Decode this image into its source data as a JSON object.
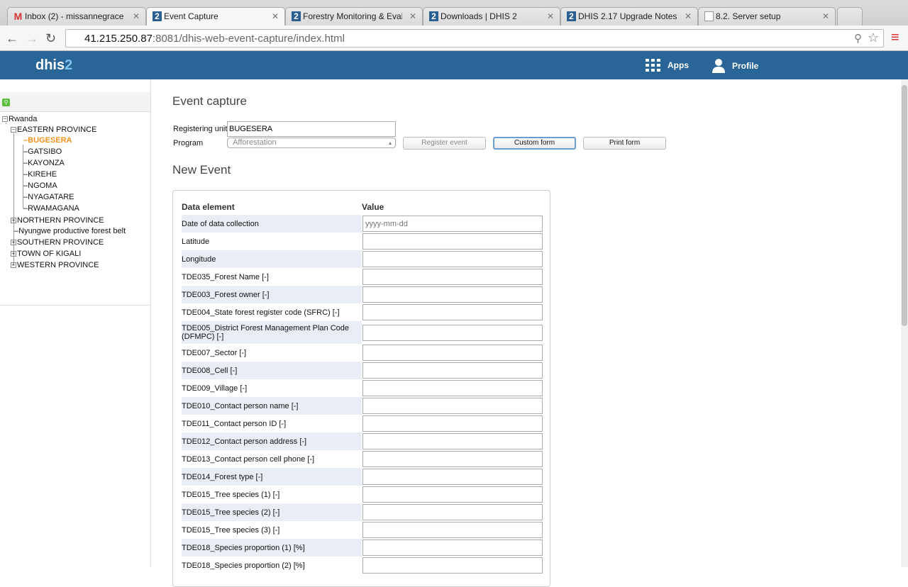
{
  "browser": {
    "tabs": [
      {
        "title": "Inbox (2) - missannegrace",
        "icon": "gmail-icon"
      },
      {
        "title": "Event Capture",
        "icon": "dhis2-icon",
        "active": true
      },
      {
        "title": "Forestry Monitoring & Eval",
        "icon": "dhis2-icon"
      },
      {
        "title": "Downloads | DHIS 2",
        "icon": "dhis2-icon"
      },
      {
        "title": "DHIS 2.17 Upgrade Notes |",
        "icon": "dhis2-icon"
      },
      {
        "title": "8.2. Server setup",
        "icon": "document-icon"
      }
    ],
    "url_host": "41.215.250.87",
    "url_rest": ":8081/dhis-web-event-capture/index.html"
  },
  "header": {
    "logo_main": "dhis",
    "logo_accent": "2",
    "apps": "Apps",
    "profile": "Profile"
  },
  "tree": {
    "root": "Rwanda",
    "nodes": [
      "EASTERN PROVINCE",
      "BUGESERA",
      "GATSIBO",
      "KAYONZA",
      "KIREHE",
      "NGOMA",
      "NYAGATARE",
      "RWAMAGANA",
      "NORTHERN PROVINCE",
      "Nyungwe productive forest belt",
      "SOUTHERN PROVINCE",
      "TOWN OF KIGALI",
      "WESTERN PROVINCE"
    ],
    "selected": "BUGESERA"
  },
  "main": {
    "title": "Event capture",
    "registering_unit_label": "Registering unit",
    "registering_unit": "BUGESERA",
    "program_label": "Program",
    "program": "Afforestation",
    "register_event": "Register event",
    "custom_form": "Custom form",
    "print_form": "Print form",
    "new_event": "New Event",
    "col_element": "Data element",
    "col_value": "Value",
    "rows": [
      {
        "label": "Date of data collection",
        "placeholder": "yyyy-mm-dd"
      },
      {
        "label": "Latitude"
      },
      {
        "label": "Longitude"
      },
      {
        "label": "TDE035_Forest Name [-]"
      },
      {
        "label": "TDE003_Forest owner [-]"
      },
      {
        "label": "TDE004_State forest register code (SFRC) [-]"
      },
      {
        "label": "TDE005_District Forest Management Plan Code (DFMPC) [-]"
      },
      {
        "label": "TDE007_Sector [-]"
      },
      {
        "label": "TDE008_Cell [-]"
      },
      {
        "label": "TDE009_Village [-]"
      },
      {
        "label": "TDE010_Contact person name [-]"
      },
      {
        "label": "TDE011_Contact person ID [-]"
      },
      {
        "label": "TDE012_Contact person address [-]"
      },
      {
        "label": "TDE013_Contact person cell phone [-]"
      },
      {
        "label": "TDE014_Forest type [-]"
      },
      {
        "label": "TDE015_Tree species (1) [-]"
      },
      {
        "label": "TDE015_Tree species (2) [-]"
      },
      {
        "label": "TDE015_Tree species (3) [-]"
      },
      {
        "label": "TDE018_Species proportion (1) [%]"
      },
      {
        "label": "TDE018_Species proportion (2) [%]"
      }
    ]
  }
}
